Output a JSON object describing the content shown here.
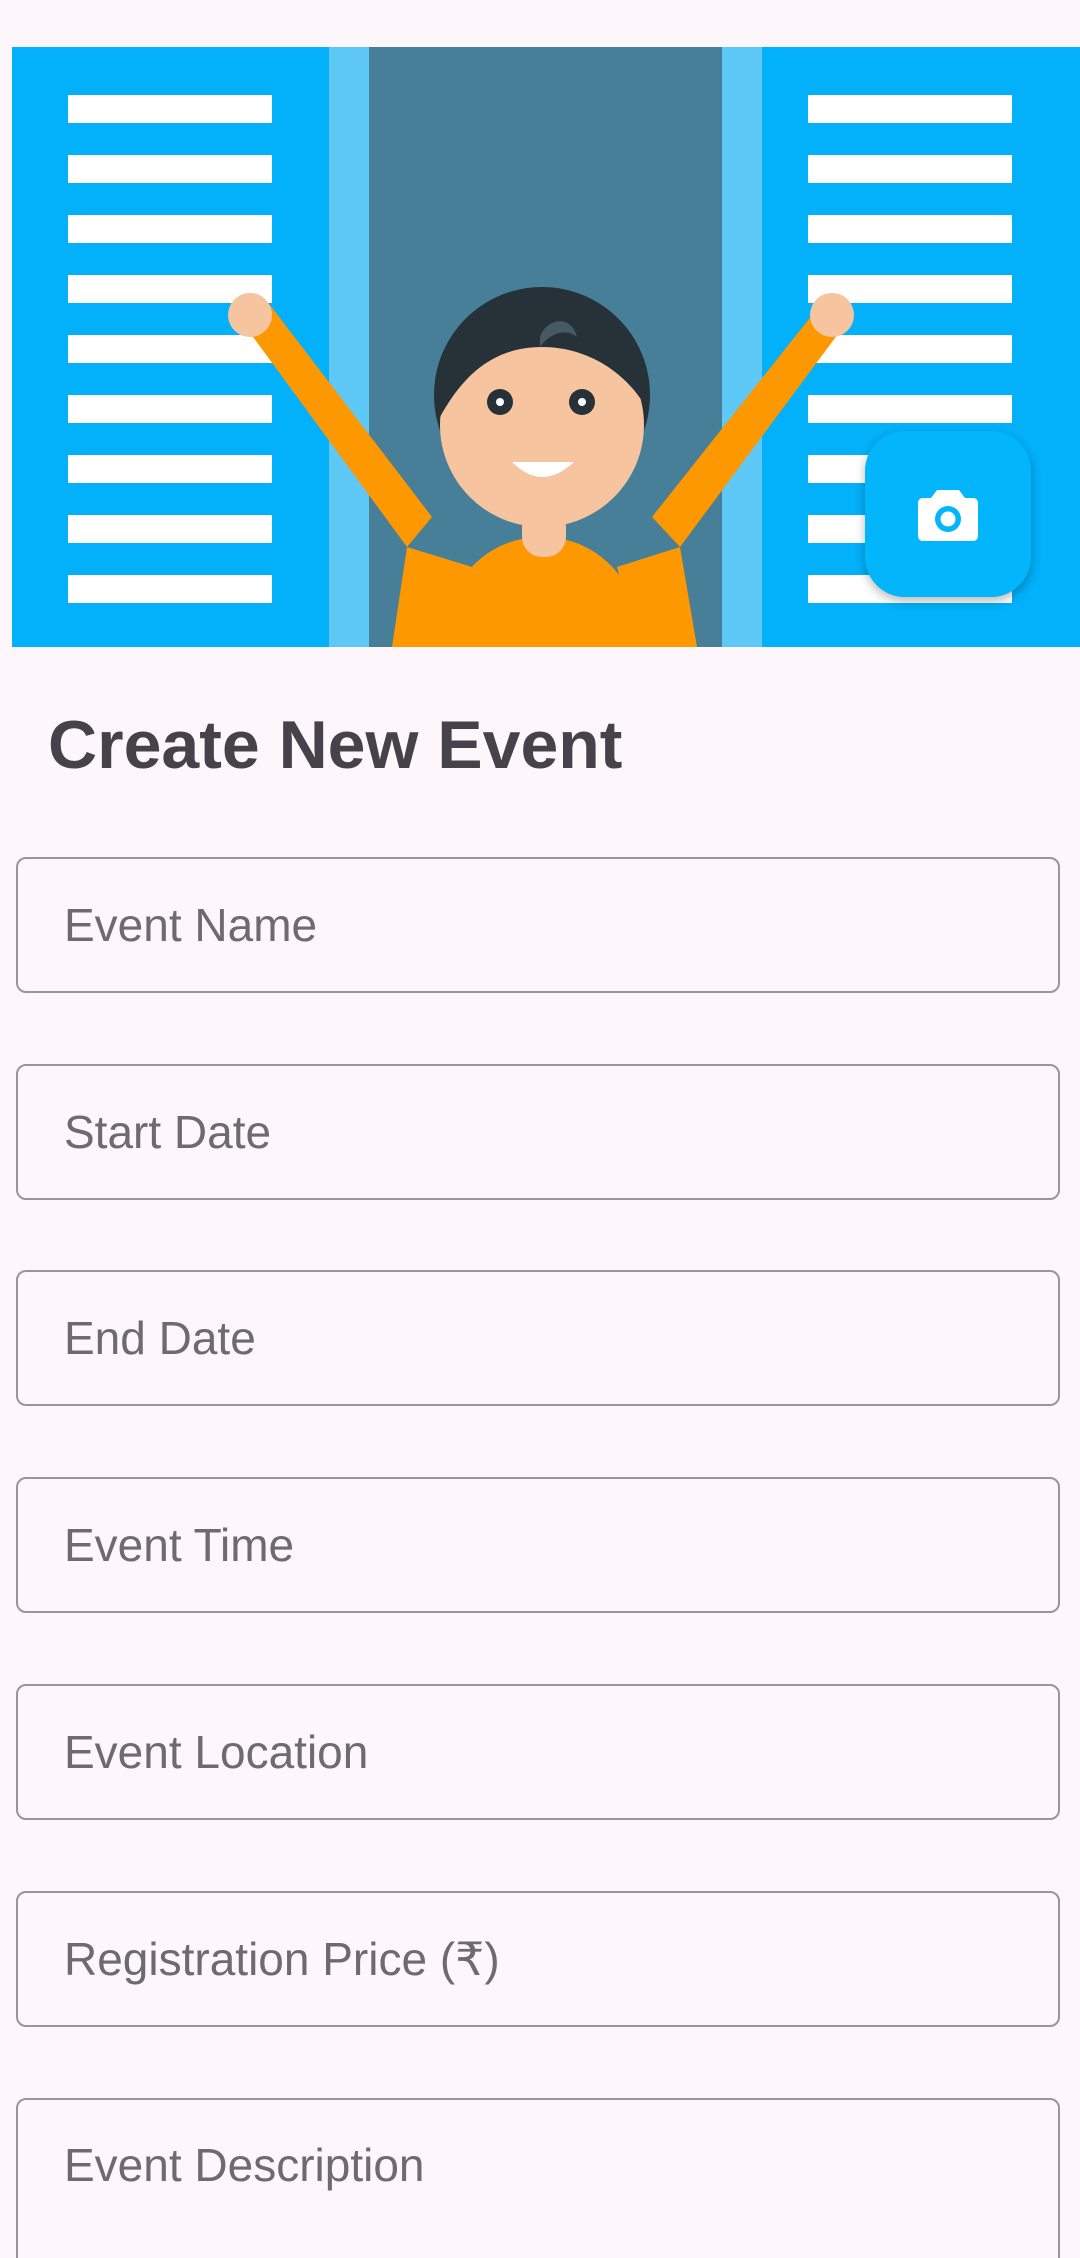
{
  "banner": {
    "illustration_icon": "person-celebrating-illustration",
    "camera_icon": "camera-icon"
  },
  "form": {
    "title": "Create New Event",
    "fields": [
      {
        "name": "event-name-field",
        "placeholder": "Event Name",
        "value": ""
      },
      {
        "name": "start-date-field",
        "placeholder": "Start Date",
        "value": ""
      },
      {
        "name": "end-date-field",
        "placeholder": "End Date",
        "value": ""
      },
      {
        "name": "event-time-field",
        "placeholder": "Event Time",
        "value": ""
      },
      {
        "name": "event-location-field",
        "placeholder": "Event Location",
        "value": ""
      },
      {
        "name": "registration-price-field",
        "placeholder": "Registration Price (₹)",
        "value": ""
      },
      {
        "name": "event-description-field",
        "placeholder": "Event Description",
        "value": ""
      }
    ]
  },
  "colors": {
    "background": "#fdf6fb",
    "accent": "#03b5fb",
    "title_text": "#47414a",
    "field_border": "#9b959b",
    "placeholder_text": "#6f6a70"
  }
}
